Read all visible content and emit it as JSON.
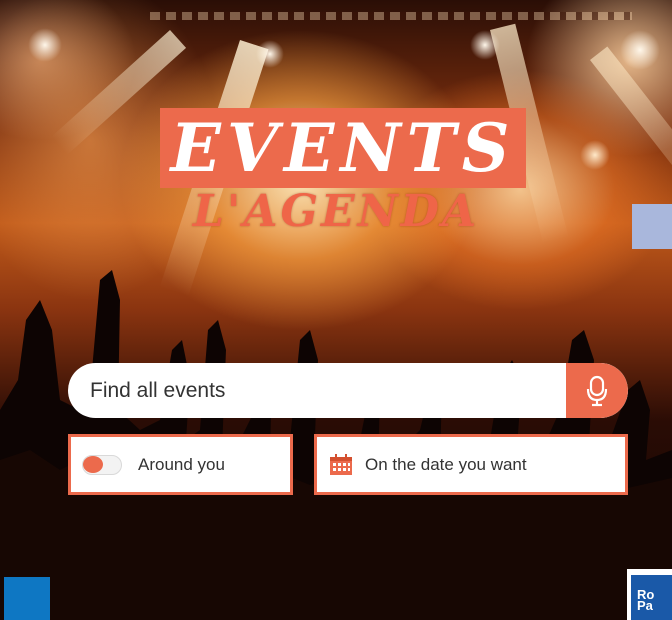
{
  "hero": {
    "title": "EVENTS",
    "subtitle": "L'AGENDA"
  },
  "search": {
    "placeholder": "Find all events",
    "mic_icon": "microphone-icon"
  },
  "filters": {
    "around_label": "Around you",
    "around_icon": "toggle-icon",
    "around_enabled": false,
    "date_label": "On the date you want",
    "date_icon": "calendar-icon"
  },
  "logo": {
    "line1": "Ro",
    "line2": "Pa"
  },
  "colors": {
    "accent": "#ec6a4c",
    "blue": "#0e77c3",
    "logo_blue": "#1a59a8",
    "lavender": "#a9b7dc"
  }
}
